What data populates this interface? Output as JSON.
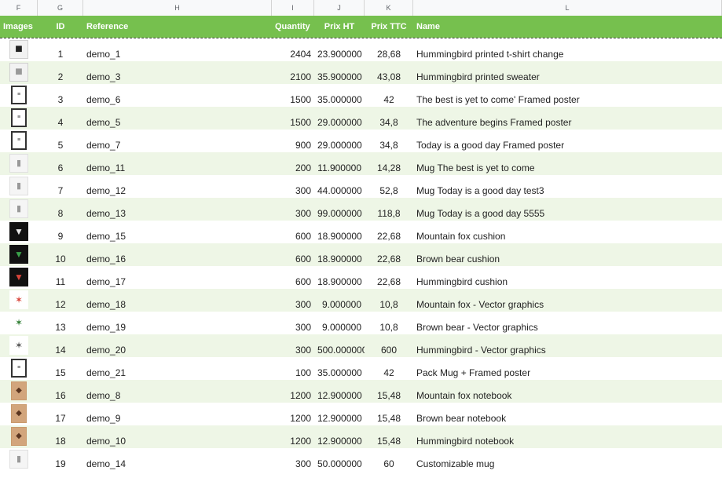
{
  "column_letters": [
    "F",
    "G",
    "H",
    "I",
    "J",
    "K",
    "L"
  ],
  "headers": {
    "images": "Images",
    "id": "ID",
    "reference": "Reference",
    "quantity": "Quantity",
    "prix_ht": "Prix HT",
    "prix_ttc": "Prix TTC",
    "name": "Name"
  },
  "rows": [
    {
      "thumb": "tshirt-thumbnail",
      "id": "1",
      "reference": "demo_1",
      "quantity": "2404",
      "prix_ht": "23.900000",
      "prix_ttc": "28,68",
      "name": "Hummingbird printed t-shirt change"
    },
    {
      "thumb": "sweater-thumbnail",
      "id": "2",
      "reference": "demo_3",
      "quantity": "2100",
      "prix_ht": "35.900000",
      "prix_ttc": "43,08",
      "name": "Hummingbird printed sweater"
    },
    {
      "thumb": "poster-thumbnail",
      "id": "3",
      "reference": "demo_6",
      "quantity": "1500",
      "prix_ht": "35.000000",
      "prix_ttc": "42",
      "name": "The best is yet to come' Framed poster"
    },
    {
      "thumb": "poster-thumbnail",
      "id": "4",
      "reference": "demo_5",
      "quantity": "1500",
      "prix_ht": "29.000000",
      "prix_ttc": "34,8",
      "name": "The adventure begins Framed poster"
    },
    {
      "thumb": "poster-thumbnail",
      "id": "5",
      "reference": "demo_7",
      "quantity": "900",
      "prix_ht": "29.000000",
      "prix_ttc": "34,8",
      "name": "Today is a good day Framed poster"
    },
    {
      "thumb": "mug-thumbnail",
      "id": "6",
      "reference": "demo_11",
      "quantity": "200",
      "prix_ht": "11.900000",
      "prix_ttc": "14,28",
      "name": "Mug The best is yet to come"
    },
    {
      "thumb": "mug-thumbnail",
      "id": "7",
      "reference": "demo_12",
      "quantity": "300",
      "prix_ht": "44.000000",
      "prix_ttc": "52,8",
      "name": "Mug Today is a good day test3"
    },
    {
      "thumb": "mug-thumbnail",
      "id": "8",
      "reference": "demo_13",
      "quantity": "300",
      "prix_ht": "99.000000",
      "prix_ttc": "118,8",
      "name": "Mug Today is a good day 5555"
    },
    {
      "thumb": "cushion-thumbnail",
      "id": "9",
      "reference": "demo_15",
      "quantity": "600",
      "prix_ht": "18.900000",
      "prix_ttc": "22,68",
      "name": "Mountain fox cushion"
    },
    {
      "thumb": "cushion-thumbnail",
      "id": "10",
      "reference": "demo_16",
      "quantity": "600",
      "prix_ht": "18.900000",
      "prix_ttc": "22,68",
      "name": "Brown bear cushion"
    },
    {
      "thumb": "cushion-thumbnail",
      "id": "11",
      "reference": "demo_17",
      "quantity": "600",
      "prix_ht": "18.900000",
      "prix_ttc": "22,68",
      "name": "Hummingbird cushion"
    },
    {
      "thumb": "vector-thumbnail",
      "id": "12",
      "reference": "demo_18",
      "quantity": "300",
      "prix_ht": "9.000000",
      "prix_ttc": "10,8",
      "name": "Mountain fox - Vector graphics"
    },
    {
      "thumb": "vector-thumbnail",
      "id": "13",
      "reference": "demo_19",
      "quantity": "300",
      "prix_ht": "9.000000",
      "prix_ttc": "10,8",
      "name": "Brown bear - Vector graphics"
    },
    {
      "thumb": "vector-thumbnail",
      "id": "14",
      "reference": "demo_20",
      "quantity": "300",
      "prix_ht": "500.000000",
      "prix_ttc": "600",
      "name": "Hummingbird - Vector graphics"
    },
    {
      "thumb": "poster-thumbnail",
      "id": "15",
      "reference": "demo_21",
      "quantity": "100",
      "prix_ht": "35.000000",
      "prix_ttc": "42",
      "name": "Pack Mug + Framed poster"
    },
    {
      "thumb": "notebook-thumbnail",
      "id": "16",
      "reference": "demo_8",
      "quantity": "1200",
      "prix_ht": "12.900000",
      "prix_ttc": "15,48",
      "name": "Mountain fox notebook"
    },
    {
      "thumb": "notebook-thumbnail",
      "id": "17",
      "reference": "demo_9",
      "quantity": "1200",
      "prix_ht": "12.900000",
      "prix_ttc": "15,48",
      "name": "Brown bear notebook"
    },
    {
      "thumb": "notebook-thumbnail",
      "id": "18",
      "reference": "demo_10",
      "quantity": "1200",
      "prix_ht": "12.900000",
      "prix_ttc": "15,48",
      "name": "Hummingbird notebook"
    },
    {
      "thumb": "mug-thumbnail",
      "id": "19",
      "reference": "demo_14",
      "quantity": "300",
      "prix_ht": "50.000000",
      "prix_ttc": "60",
      "name": "Customizable mug"
    }
  ],
  "colors": {
    "header_green": "#76c04e",
    "row_alt": "#eef6e6"
  }
}
